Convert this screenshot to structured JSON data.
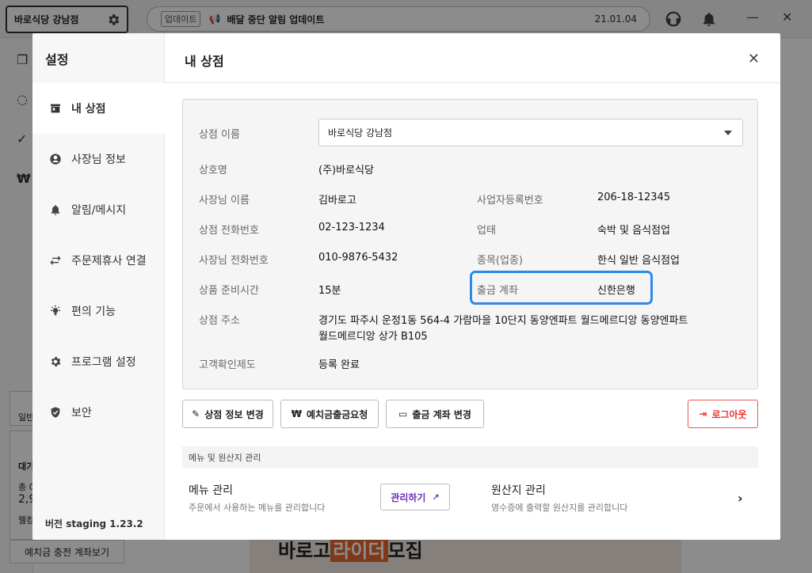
{
  "topbar": {
    "store_name": "바로식당 강남점",
    "notice_tag": "업데이트",
    "notice_text": "배달 중단 알림 업데이트",
    "notice_date": "21.01.04",
    "minimize": "—",
    "close": "✕"
  },
  "background": {
    "card_label_1": "일반",
    "card_label_2": "대기",
    "card_value": "총 0",
    "card_value_2": "2,9",
    "card_footer": "웰컴",
    "deposit_link": "예치금 충전 계좌보기",
    "banner_text_a": "바로고",
    "banner_text_b": "라이더",
    "banner_text_c": "모집"
  },
  "settings": {
    "title": "설정",
    "version": "버전 staging 1.23.2",
    "items": [
      {
        "label": "내 상점",
        "icon": "store-icon"
      },
      {
        "label": "사장님 정보",
        "icon": "user-circle-icon"
      },
      {
        "label": "알림/메시지",
        "icon": "bell-icon"
      },
      {
        "label": "주문제휴사 연결",
        "icon": "swap-arrows-icon"
      },
      {
        "label": "편의 기능",
        "icon": "lightbulb-icon"
      },
      {
        "label": "프로그램 설정",
        "icon": "gear-icon"
      },
      {
        "label": "보안",
        "icon": "shield-check-icon"
      }
    ]
  },
  "store": {
    "page_title": "내 상점",
    "fields": {
      "store_name_label": "상점 이름",
      "store_name_value": "바로식당 강남점",
      "company_label": "상호명",
      "company_value": "(주)바로식당",
      "owner_label": "사장님 이름",
      "owner_value": "김바로고",
      "bizno_label": "사업자등록번호",
      "bizno_value": "206-18-12345",
      "phone_label": "상점 전화번호",
      "phone_value": "02-123-1234",
      "biztype_label": "업태",
      "biztype_value": "숙박 및 음식점업",
      "owner_phone_label": "사장님 전화번호",
      "owner_phone_value": "010-9876-5432",
      "category_label": "종목(업종)",
      "category_value": "한식 일반 음식점업",
      "prep_label": "상품 준비시간",
      "prep_value": "15분",
      "account_label": "출금 계좌",
      "account_value": "신한은행",
      "address_label": "상점 주소",
      "address_line1": "경기도 파주시 운정1동 564-4 가람마을 10단지 동양엔파트 월드메르디앙 동양엔파트",
      "address_line2": "월드메르디앙 상가 B105",
      "verify_label": "고객확인제도",
      "verify_value": "등록 완료"
    },
    "buttons": {
      "edit_store": "상점 정보 변경",
      "deposit_request": "예치금출금요청",
      "change_account": "출금 계좌 변경",
      "logout": "로그아웃"
    },
    "menu_section": {
      "header": "메뉴 및 원산지 관리",
      "menu_title": "메뉴 관리",
      "menu_desc": "주문에서 사용하는 메뉴를 관리합니다",
      "manage_button": "관리하기",
      "origin_title": "원산지 관리",
      "origin_desc": "영수증에 출력할 원산지를 관리합니다"
    }
  },
  "colors": {
    "highlight": "#2b8ae8",
    "logout": "#e33333",
    "manage": "#6b2bb8"
  }
}
